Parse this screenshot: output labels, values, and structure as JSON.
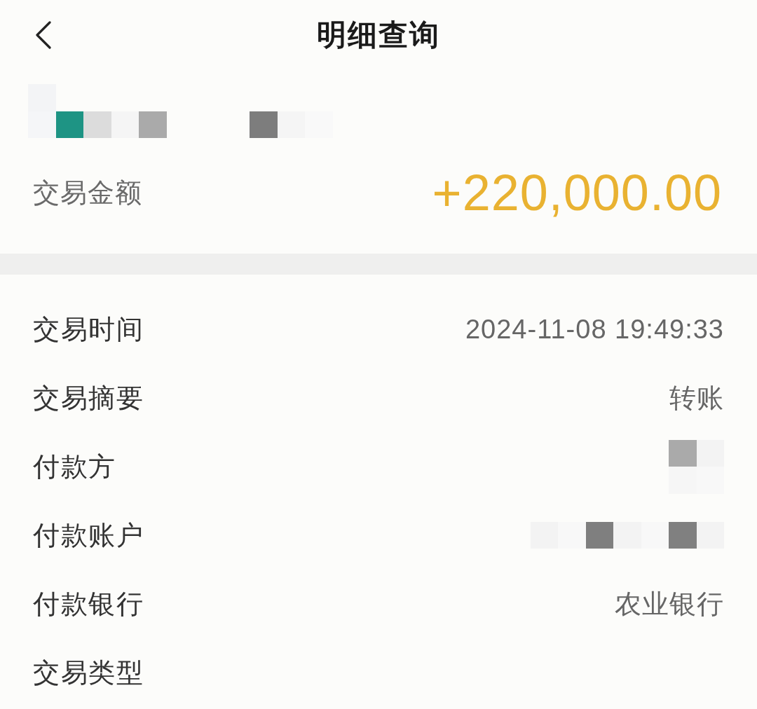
{
  "header": {
    "title": "明细查询"
  },
  "account": {
    "kind": "redacted"
  },
  "amount": {
    "label": "交易金额",
    "value": "+220,000.00"
  },
  "details": [
    {
      "label": "交易时间",
      "kind": "text",
      "value": "2024-11-08 19:49:33"
    },
    {
      "label": "交易摘要",
      "kind": "text",
      "value": "转账"
    },
    {
      "label": "付款方",
      "kind": "redacted"
    },
    {
      "label": "付款账户",
      "kind": "redacted"
    },
    {
      "label": "付款银行",
      "kind": "text",
      "value": "农业银行"
    },
    {
      "label": "交易类型",
      "kind": "blank"
    }
  ]
}
